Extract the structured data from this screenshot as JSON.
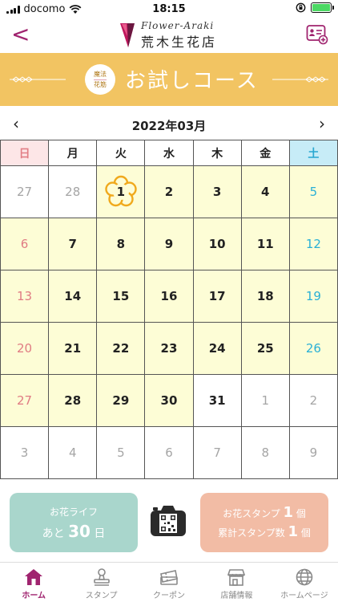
{
  "status": {
    "carrier": "docomo",
    "time": "18:15"
  },
  "header": {
    "back_glyph": "<",
    "logo_en": "Flower-Araki",
    "logo_jp": "荒木生花店"
  },
  "banner": {
    "badge_top": "魔法",
    "badge_bottom": "花筋",
    "title": "お試しコース"
  },
  "calendar": {
    "month_label": "2022年03月",
    "prev_glyph": "‹",
    "next_glyph": "›",
    "weekdays": [
      "日",
      "月",
      "火",
      "水",
      "木",
      "金",
      "土"
    ],
    "weeks": [
      [
        "27",
        "28",
        "1",
        "2",
        "3",
        "4",
        "5"
      ],
      [
        "6",
        "7",
        "8",
        "9",
        "10",
        "11",
        "12"
      ],
      [
        "13",
        "14",
        "15",
        "16",
        "17",
        "18",
        "19"
      ],
      [
        "20",
        "21",
        "22",
        "23",
        "24",
        "25",
        "26"
      ],
      [
        "27",
        "28",
        "29",
        "30",
        "31",
        "1",
        "2"
      ],
      [
        "3",
        "4",
        "5",
        "6",
        "7",
        "8",
        "9"
      ]
    ],
    "highlight_color": "#fdfdd6",
    "marker_color": "#f0a91c"
  },
  "panels": {
    "life_line1": "お花ライフ",
    "life_prefix": "あと",
    "life_days": "30",
    "life_suffix": "日",
    "stamp_label": "お花スタンプ",
    "stamp_count": "1",
    "stamp_unit": "個",
    "total_label": "累計スタンプ数",
    "total_count": "1",
    "total_unit": "個"
  },
  "tabs": [
    {
      "label": "ホーム",
      "icon": "house-icon"
    },
    {
      "label": "スタンプ",
      "icon": "stamp-icon"
    },
    {
      "label": "クーポン",
      "icon": "coupon-icon"
    },
    {
      "label": "店舗情報",
      "icon": "shop-icon"
    },
    {
      "label": "ホームページ",
      "icon": "globe-icon"
    }
  ],
  "colors": {
    "accent": "#a0246f",
    "banner": "#f2c462",
    "life_panel": "#a9d6cc",
    "stamp_panel": "#f2bca5"
  }
}
